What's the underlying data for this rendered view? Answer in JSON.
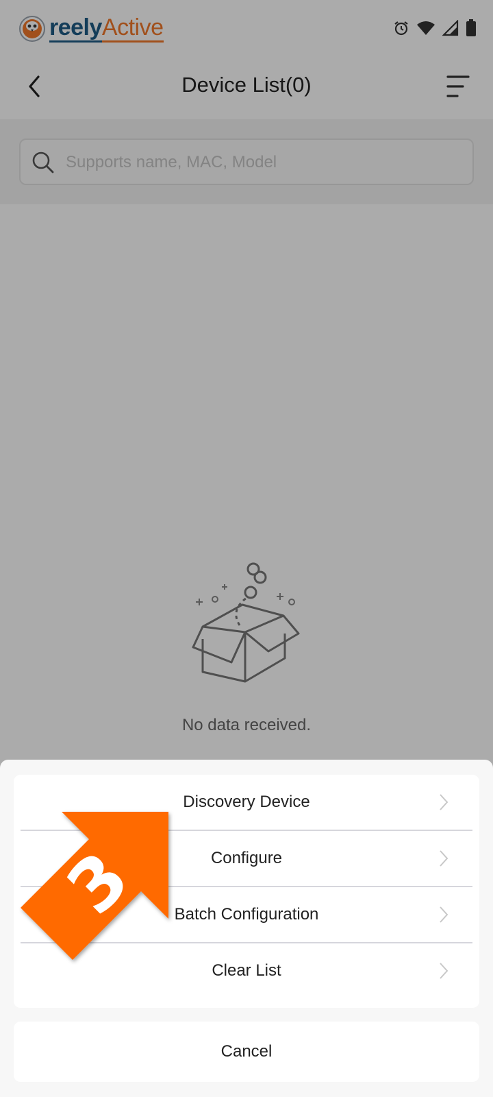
{
  "status_bar": {
    "logo_reely": "reely",
    "logo_active": "Active",
    "icons": [
      "alarm-icon",
      "wifi-icon",
      "signal-icon",
      "battery-icon"
    ]
  },
  "header": {
    "title": "Device List(0)",
    "back_icon": "chevron-left-icon",
    "filter_icon": "sort-icon"
  },
  "search": {
    "placeholder": "Supports name, MAC, Model"
  },
  "empty_state": {
    "message": "No data received."
  },
  "action_sheet": {
    "items": [
      {
        "label": "Discovery Device"
      },
      {
        "label": "Configure"
      },
      {
        "label": "Batch Configuration"
      },
      {
        "label": "Clear List"
      }
    ],
    "cancel_label": "Cancel"
  },
  "annotation": {
    "step_number": "3",
    "color": "#ff6a00"
  },
  "colors": {
    "brand_blue": "#1e5c85",
    "brand_orange": "#f0782a",
    "overlay": "rgba(0,0,0,0.33)"
  }
}
